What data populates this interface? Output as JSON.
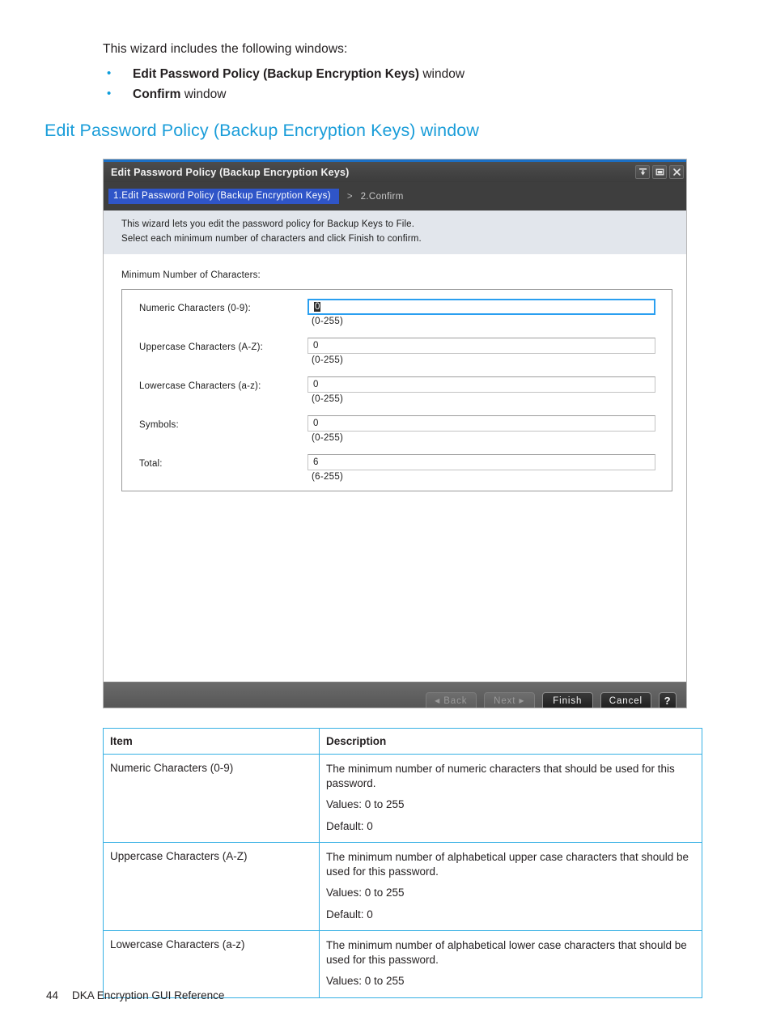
{
  "prose": {
    "intro": "This wizard includes the following windows:",
    "bullets": [
      {
        "bold": "Edit Password Policy (Backup Encryption Keys)",
        "rest": " window"
      },
      {
        "bold": "Confirm",
        "rest": " window"
      }
    ],
    "heading": "Edit Password Policy (Backup Encryption Keys) window"
  },
  "dialog": {
    "title": "Edit Password Policy (Backup Encryption Keys)",
    "window_controls": [
      "collapse-icon",
      "maximize-icon",
      "close-icon"
    ],
    "breadcrumb": {
      "active": "1.Edit Password Policy (Backup Encryption Keys)",
      "separator": ">",
      "next": "2.Confirm"
    },
    "instructions": [
      "This wizard lets you edit the password policy for Backup Keys to File.",
      "Select each minimum number of characters and click Finish to confirm."
    ],
    "group_caption": "Minimum Number of Characters:",
    "fields": [
      {
        "label": "Numeric Characters (0-9):",
        "value": "0",
        "hint": "(0-255)",
        "focused": true
      },
      {
        "label": "Uppercase Characters (A-Z):",
        "value": "0",
        "hint": "(0-255)",
        "focused": false
      },
      {
        "label": "Lowercase Characters (a-z):",
        "value": "0",
        "hint": "(0-255)",
        "focused": false
      },
      {
        "label": "Symbols:",
        "value": "0",
        "hint": "(0-255)",
        "focused": false
      },
      {
        "label": "Total:",
        "value": "6",
        "hint": "(6-255)",
        "focused": false
      }
    ],
    "buttons": {
      "back": "Back",
      "next": "Next",
      "finish": "Finish",
      "cancel": "Cancel",
      "help": "?"
    },
    "colors": {
      "titlebar": "#3f3f3f",
      "breadcrumb_active": "#2f55c8",
      "instruction_band": "#e2e6ec",
      "focus_border": "#2a9ff0",
      "top_accent": "#1b6fc4"
    }
  },
  "table": {
    "headers": [
      "Item",
      "Description"
    ],
    "rows": [
      {
        "item": "Numeric Characters (0-9)",
        "desc": [
          "The minimum number of numeric characters that should be used for this password.",
          "Values: 0 to 255",
          "Default: 0"
        ]
      },
      {
        "item": "Uppercase Characters (A-Z)",
        "desc": [
          "The minimum number of alphabetical upper case characters that should be used for this password.",
          "Values: 0 to 255",
          "Default: 0"
        ]
      },
      {
        "item": "Lowercase Characters (a-z)",
        "desc": [
          "The minimum number of alphabetical lower case characters that should be used for this password.",
          "Values: 0 to 255"
        ]
      }
    ],
    "border_color": "#36b0e4"
  },
  "footer": {
    "page_number": "44",
    "book_title": "DKA Encryption GUI Reference"
  }
}
